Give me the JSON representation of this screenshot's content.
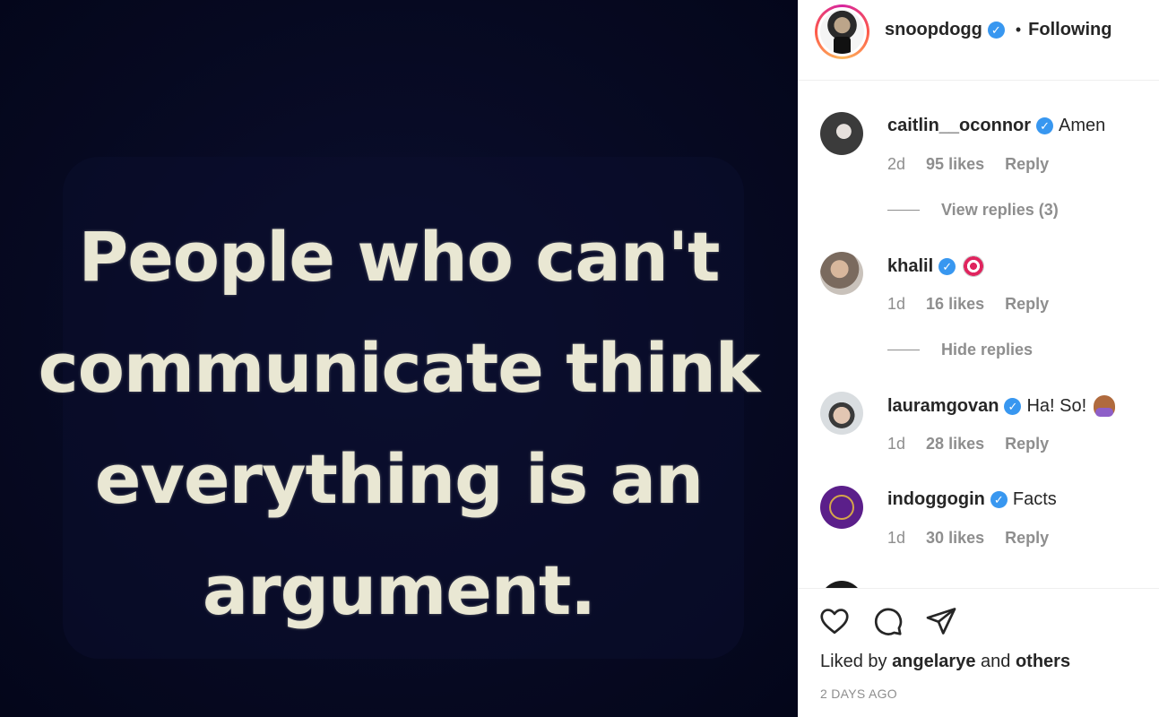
{
  "post": {
    "quote_lines": [
      "People who can't",
      "communicate think",
      "everything is an",
      "argument."
    ]
  },
  "header": {
    "username": "snoopdogg",
    "separator": "•",
    "follow_status": "Following"
  },
  "comments": [
    {
      "username": "caitlin__oconnor",
      "text": "Amen",
      "time": "2d",
      "likes": "95 likes",
      "reply": "Reply",
      "thread_action": "View replies (3)"
    },
    {
      "username": "khalil",
      "text": "",
      "emoji": "direct-hit",
      "time": "1d",
      "likes": "16 likes",
      "reply": "Reply",
      "thread_action": "Hide replies"
    },
    {
      "username": "lauramgovan",
      "text": "Ha! So!",
      "emoji": "person-shrugging",
      "time": "1d",
      "likes": "28 likes",
      "reply": "Reply"
    },
    {
      "username": "indoggogin",
      "text": "Facts",
      "time": "1d",
      "likes": "30 likes",
      "reply": "Reply"
    }
  ],
  "footer": {
    "liked_prefix": "Liked by",
    "liked_user": "angelarye",
    "liked_and": "and",
    "liked_others": "others",
    "timestamp": "2 DAYS AGO"
  },
  "icons": {
    "like": "heart-icon",
    "comment": "comment-icon",
    "share": "paper-plane-icon",
    "verified": "verified-badge-icon"
  },
  "colors": {
    "verified": "#3897f0",
    "muted": "#8e8e8e",
    "text": "#262626",
    "image_bg": "#070a23",
    "quote_text": "#e9e7d3"
  }
}
